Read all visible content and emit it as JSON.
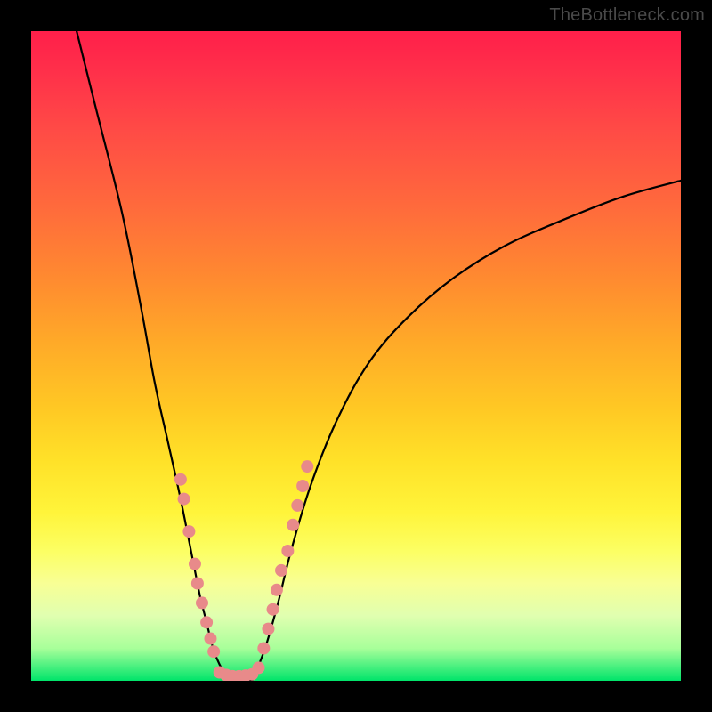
{
  "watermark": "TheBottleneck.com",
  "chart_data": {
    "type": "line",
    "title": "",
    "xlabel": "",
    "ylabel": "",
    "xlim": [
      0,
      100
    ],
    "ylim": [
      0,
      100
    ],
    "series": [
      {
        "name": "left-curve",
        "x": [
          7,
          10,
          14,
          17,
          19,
          21,
          23,
          25,
          26,
          27,
          28,
          29,
          30,
          31
        ],
        "values": [
          100,
          88,
          72,
          57,
          46,
          37,
          28,
          18,
          13,
          9,
          5,
          2.5,
          1,
          0
        ]
      },
      {
        "name": "right-curve",
        "x": [
          34,
          36,
          38,
          40,
          43,
          47,
          52,
          58,
          65,
          73,
          82,
          91,
          100
        ],
        "values": [
          0,
          5,
          12,
          20,
          30,
          40,
          49,
          56,
          62,
          67,
          71,
          74.5,
          77
        ]
      },
      {
        "name": "bottom-gap",
        "x": [
          31,
          34
        ],
        "values": [
          0,
          0
        ]
      }
    ],
    "markers_left": {
      "name": "dots-left",
      "color": "#e88a8a",
      "points": [
        {
          "x": 23.0,
          "y": 31
        },
        {
          "x": 23.5,
          "y": 28
        },
        {
          "x": 24.3,
          "y": 23
        },
        {
          "x": 25.2,
          "y": 18
        },
        {
          "x": 25.6,
          "y": 15
        },
        {
          "x": 26.3,
          "y": 12
        },
        {
          "x": 27.0,
          "y": 9
        },
        {
          "x": 27.6,
          "y": 6.5
        },
        {
          "x": 28.1,
          "y": 4.5
        }
      ]
    },
    "markers_right": {
      "name": "dots-right",
      "color": "#e88a8a",
      "points": [
        {
          "x": 35.8,
          "y": 5
        },
        {
          "x": 36.5,
          "y": 8
        },
        {
          "x": 37.2,
          "y": 11
        },
        {
          "x": 37.8,
          "y": 14
        },
        {
          "x": 38.5,
          "y": 17
        },
        {
          "x": 39.5,
          "y": 20
        },
        {
          "x": 40.3,
          "y": 24
        },
        {
          "x": 41.0,
          "y": 27
        },
        {
          "x": 41.8,
          "y": 30
        },
        {
          "x": 42.5,
          "y": 33
        }
      ]
    },
    "bottom_cluster": {
      "name": "dots-bottom",
      "color": "#e88a8a",
      "points": [
        {
          "x": 29.0,
          "y": 1.3
        },
        {
          "x": 30.0,
          "y": 0.9
        },
        {
          "x": 31.0,
          "y": 0.7
        },
        {
          "x": 32.0,
          "y": 0.7
        },
        {
          "x": 33.0,
          "y": 0.8
        },
        {
          "x": 34.0,
          "y": 1.0
        },
        {
          "x": 35.0,
          "y": 2.0
        }
      ]
    },
    "gradient_stops": [
      {
        "pos": 0.0,
        "color": "#ff1f4a"
      },
      {
        "pos": 0.5,
        "color": "#ffb726"
      },
      {
        "pos": 0.8,
        "color": "#fcff63"
      },
      {
        "pos": 1.0,
        "color": "#00e46a"
      }
    ]
  }
}
